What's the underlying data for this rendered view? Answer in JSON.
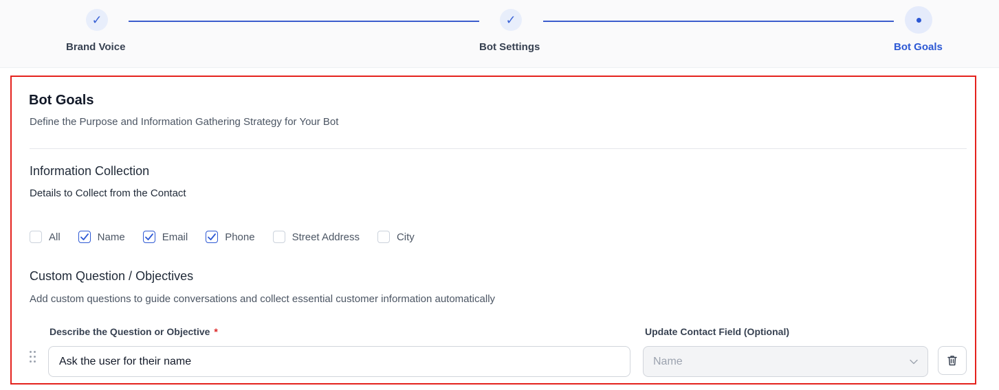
{
  "stepper": {
    "steps": [
      {
        "label": "Brand Voice",
        "status": "complete",
        "icon": "check-icon"
      },
      {
        "label": "Bot Settings",
        "status": "complete",
        "icon": "check-icon"
      },
      {
        "label": "Bot Goals",
        "status": "active",
        "icon": "dot-icon"
      }
    ],
    "check_glyph": "✓"
  },
  "section": {
    "title": "Bot Goals",
    "subtitle": "Define the Purpose and Information Gathering Strategy for Your Bot"
  },
  "info_collection": {
    "heading": "Information Collection",
    "subheading": "Details to Collect from the Contact",
    "options": [
      {
        "label": "All",
        "checked": false
      },
      {
        "label": "Name",
        "checked": true
      },
      {
        "label": "Email",
        "checked": true
      },
      {
        "label": "Phone",
        "checked": true
      },
      {
        "label": "Street Address",
        "checked": false
      },
      {
        "label": "City",
        "checked": false
      }
    ]
  },
  "custom_questions": {
    "heading": "Custom Question / Objectives",
    "description": "Add custom questions to guide conversations and collect essential customer information automatically",
    "question_label": "Describe the Question or Objective",
    "required_mark": "*",
    "field_label": "Update Contact Field (Optional)",
    "rows": [
      {
        "question": "Ask the user for their name",
        "field_placeholder": "Name"
      }
    ]
  },
  "colors": {
    "accent": "#2c58d4",
    "highlight_border": "#e4211c",
    "required": "#dc2626"
  }
}
